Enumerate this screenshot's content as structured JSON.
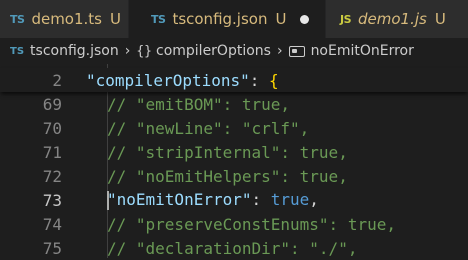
{
  "tabs": [
    {
      "icon": "TS",
      "label": "demo1.ts",
      "status": "U"
    },
    {
      "icon": "TS",
      "label": "tsconfig.json",
      "status": "U"
    },
    {
      "icon": "JS",
      "label": "demo1.js",
      "status": "U"
    }
  ],
  "breadcrumb": {
    "file_icon": "TS",
    "file": "tsconfig.json",
    "object_icon": "{}",
    "section": "compilerOptions",
    "property": "noEmitOnError"
  },
  "sticky_line": {
    "number": "2",
    "key": "\"compilerOptions\"",
    "colon": ": ",
    "brace": "{"
  },
  "lines": [
    {
      "number": "69",
      "text": "// \"emitBOM\": true,"
    },
    {
      "number": "70",
      "text": "// \"newLine\": \"crlf\","
    },
    {
      "number": "71",
      "text": "// \"stripInternal\": true,"
    },
    {
      "number": "72",
      "text": "// \"noEmitHelpers\": true,"
    },
    {
      "number": "73",
      "key": "\"noEmitOnError\"",
      "colon": ": ",
      "value": "true",
      "comma": ","
    },
    {
      "number": "74",
      "text": "// \"preserveConstEnums\": true,"
    },
    {
      "number": "75",
      "text": "// \"declarationDir\": \"./\","
    }
  ],
  "colors": {
    "background": "#1e1e1e",
    "comment": "#6a9955",
    "property_key": "#9cdcfe",
    "keyword": "#569cd6",
    "tab_label": "#d7ba7d"
  }
}
